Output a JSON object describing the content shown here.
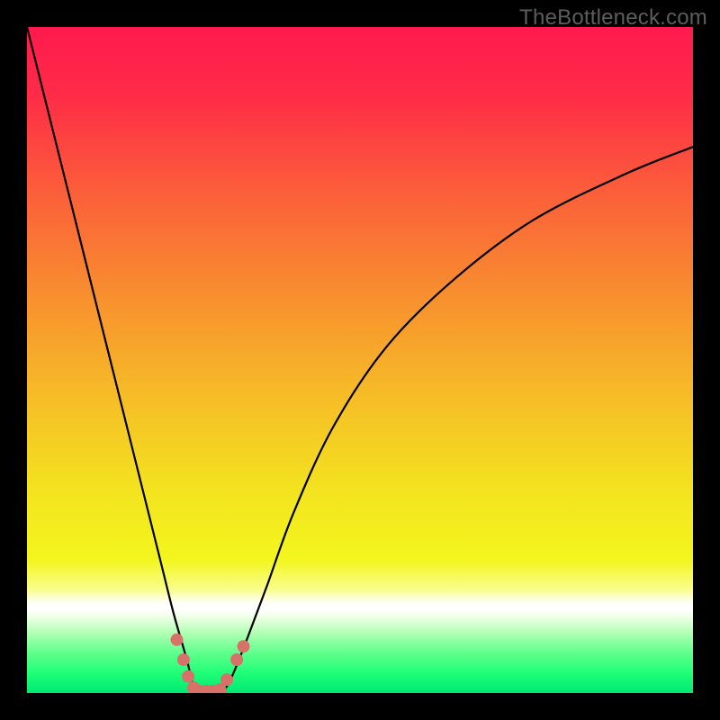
{
  "watermark": "TheBottleneck.com",
  "chart_data": {
    "type": "line",
    "title": "",
    "xlabel": "",
    "ylabel": "",
    "xlim": [
      0,
      100
    ],
    "ylim": [
      0,
      100
    ],
    "grid": false,
    "series": [
      {
        "name": "bottleneck-curve",
        "x": [
          0,
          4,
          8,
          12,
          16,
          20,
          22,
          24,
          25,
          26,
          27,
          29,
          30,
          31,
          33,
          36,
          40,
          46,
          54,
          64,
          76,
          90,
          100
        ],
        "y": [
          100,
          84,
          68,
          52,
          36,
          20,
          12,
          5,
          1,
          0,
          0,
          0,
          1,
          3,
          8,
          16,
          27,
          40,
          52,
          62,
          71,
          78,
          82
        ]
      }
    ],
    "markers": [
      {
        "name": "marker",
        "x": 22.5,
        "y": 8
      },
      {
        "name": "marker",
        "x": 23.5,
        "y": 5
      },
      {
        "name": "marker",
        "x": 24.2,
        "y": 2.5
      },
      {
        "name": "marker",
        "x": 25.0,
        "y": 0.8
      },
      {
        "name": "marker",
        "x": 26.0,
        "y": 0.3
      },
      {
        "name": "marker",
        "x": 27.0,
        "y": 0.3
      },
      {
        "name": "marker",
        "x": 28.0,
        "y": 0.3
      },
      {
        "name": "marker",
        "x": 29.0,
        "y": 0.5
      },
      {
        "name": "marker",
        "x": 30.0,
        "y": 2.0
      },
      {
        "name": "marker",
        "x": 31.5,
        "y": 5
      },
      {
        "name": "marker",
        "x": 32.5,
        "y": 7
      }
    ],
    "background_gradient": {
      "stops": [
        {
          "offset": 0.0,
          "color": "#ff1a4e"
        },
        {
          "offset": 0.1,
          "color": "#ff2b47"
        },
        {
          "offset": 0.25,
          "color": "#fb5f3a"
        },
        {
          "offset": 0.4,
          "color": "#f88e2f"
        },
        {
          "offset": 0.55,
          "color": "#f6bb27"
        },
        {
          "offset": 0.7,
          "color": "#f3e41f"
        },
        {
          "offset": 0.8,
          "color": "#f3f61e"
        },
        {
          "offset": 0.845,
          "color": "#fafd8d"
        },
        {
          "offset": 0.86,
          "color": "#fdfee2"
        },
        {
          "offset": 0.867,
          "color": "#ffffff"
        },
        {
          "offset": 0.874,
          "color": "#ffffff"
        },
        {
          "offset": 0.885,
          "color": "#f1ffe8"
        },
        {
          "offset": 0.91,
          "color": "#b0ffb3"
        },
        {
          "offset": 0.94,
          "color": "#5fff8c"
        },
        {
          "offset": 0.97,
          "color": "#1fff77"
        },
        {
          "offset": 1.0,
          "color": "#00e874"
        }
      ]
    },
    "curve_color": "#000000",
    "marker_color": "#d77169"
  }
}
